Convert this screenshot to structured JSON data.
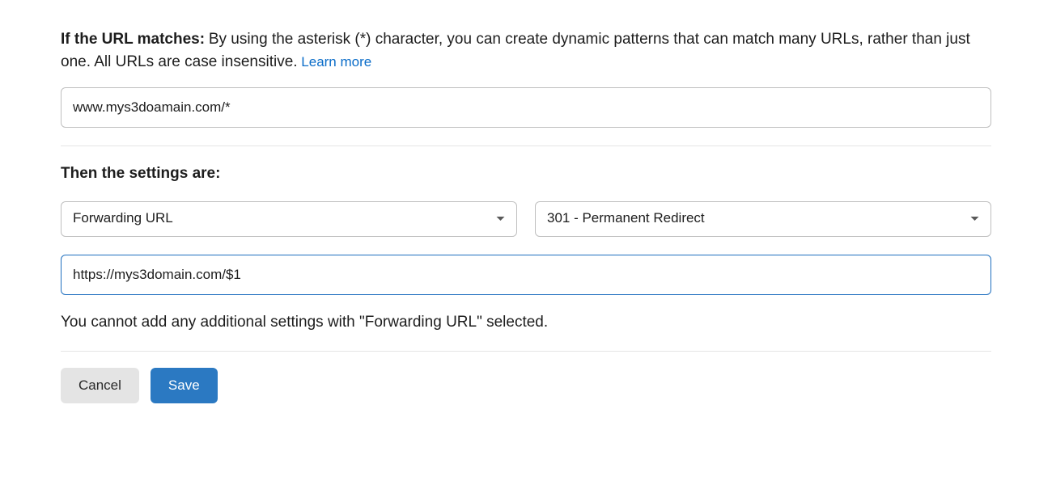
{
  "intro": {
    "heading": "If the URL matches:",
    "description": "By using the asterisk (*) character, you can create dynamic patterns that can match many URLs, rather than just one. All URLs are case insensitive.",
    "learn_more": "Learn more"
  },
  "url_input": {
    "value": "www.mys3doamain.com/*"
  },
  "settings": {
    "heading": "Then the settings are:",
    "setting_type": "Forwarding URL",
    "redirect_type": "301 - Permanent Redirect",
    "destination_value": "https://mys3domain.com/$1",
    "note": "You cannot add any additional settings with \"Forwarding URL\" selected."
  },
  "buttons": {
    "cancel": "Cancel",
    "save": "Save"
  }
}
